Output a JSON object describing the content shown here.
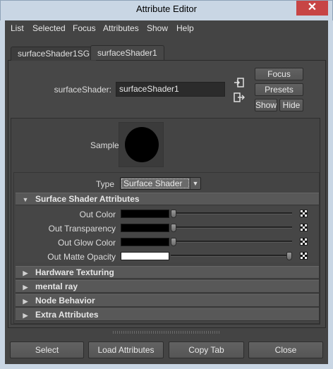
{
  "window": {
    "title": "Attribute Editor",
    "close_glyph": "✕"
  },
  "menu": [
    "List",
    "Selected",
    "Focus",
    "Attributes",
    "Show",
    "Help"
  ],
  "tabs": [
    {
      "label": "surfaceShader1SG",
      "active": false
    },
    {
      "label": "surfaceShader1",
      "active": true
    }
  ],
  "node": {
    "label": "surfaceShader:",
    "value": "surfaceShader1"
  },
  "side_buttons": {
    "focus": "Focus",
    "presets": "Presets",
    "show": "Show",
    "hide": "Hide"
  },
  "icons": {
    "input_connection": "arrow-in-icon",
    "output_connection": "arrow-out-icon"
  },
  "sample": {
    "label": "Sample",
    "swatch_color": "#000000"
  },
  "type": {
    "label": "Type",
    "value": "Surface Shader"
  },
  "sections": {
    "surface_shader": "Surface Shader Attributes",
    "hardware_texturing": "Hardware Texturing",
    "mental_ray": "mental ray",
    "node_behavior": "Node Behavior",
    "extra_attributes": "Extra Attributes"
  },
  "attributes": [
    {
      "label": "Out Color",
      "color": "#000000",
      "value": 0.0
    },
    {
      "label": "Out Transparency",
      "color": "#000000",
      "value": 0.0
    },
    {
      "label": "Out Glow Color",
      "color": "#000000",
      "value": 0.0
    },
    {
      "label": "Out Matte Opacity",
      "color": "#ffffff",
      "value": 1.0
    }
  ],
  "bottom_buttons": [
    "Select",
    "Load Attributes",
    "Copy Tab",
    "Close"
  ]
}
